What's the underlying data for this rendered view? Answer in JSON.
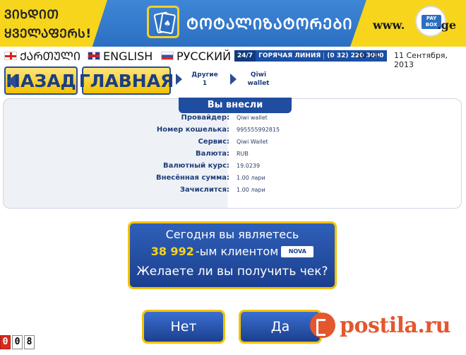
{
  "header": {
    "promo_line1": "ᲕᲘᲮᲓᲘᲗ",
    "promo_line2": "ᲧᲕᲔᲚᲐᲤᲔᲠᲡ!",
    "section_title": "ᲢᲝᲢᲐᲚᲘᲖᲐᲢᲝᲠᲔᲑᲘ",
    "site_www": "www.",
    "site_ge": ".ge",
    "paybox_label": "PAY BOX"
  },
  "languages": [
    {
      "label": "ᲥᲐᲠᲗᲣᲚᲘ"
    },
    {
      "label": "ENGLISH"
    },
    {
      "label": "РУССКИЙ"
    }
  ],
  "hotline": {
    "tag": "24/7",
    "label": "ГОРЯЧАЯ ЛИНИЯ",
    "number": "(0 32) 220 3000"
  },
  "time": "10:24",
  "date": "11 Сентября, 2013",
  "nav": {
    "back_label": "НАЗАД",
    "home_label": "ГЛАВНАЯ"
  },
  "breadcrumbs": [
    {
      "line1": "Другие",
      "line2": "1"
    },
    {
      "line1": "Qiwi",
      "line2": "wallet"
    }
  ],
  "details": {
    "title": "Вы внесли",
    "rows": [
      {
        "label": "Провайдер:",
        "value": "Qiwi wallet"
      },
      {
        "label": "Номер кошелька:",
        "value": "995555992815"
      },
      {
        "label": "Сервис:",
        "value": "Qiwi Wallet"
      },
      {
        "label": "Валюта:",
        "value": "RUB"
      },
      {
        "label": "Валютный курс:",
        "value": "19.0239"
      },
      {
        "label": "Внесённая сумма:",
        "value": "1.00 лари"
      },
      {
        "label": "Зачислится:",
        "value": "1.00 лари"
      }
    ]
  },
  "prompt": {
    "line1": "Сегодня вы являетесь",
    "count": "38 992",
    "line2_suffix": "-ым клиентом",
    "nova_label": "NOVA",
    "line3": "Желаете ли вы получить чек?"
  },
  "choices": {
    "no_label": "Нет",
    "yes_label": "Да"
  },
  "timer": {
    "digits": [
      "0",
      "0",
      "8"
    ]
  },
  "watermark": {
    "text": "postila.ru"
  },
  "colors": {
    "accent_blue": "#1f4da0",
    "accent_yellow": "#f4c200",
    "brand_orange": "#e4572e"
  }
}
